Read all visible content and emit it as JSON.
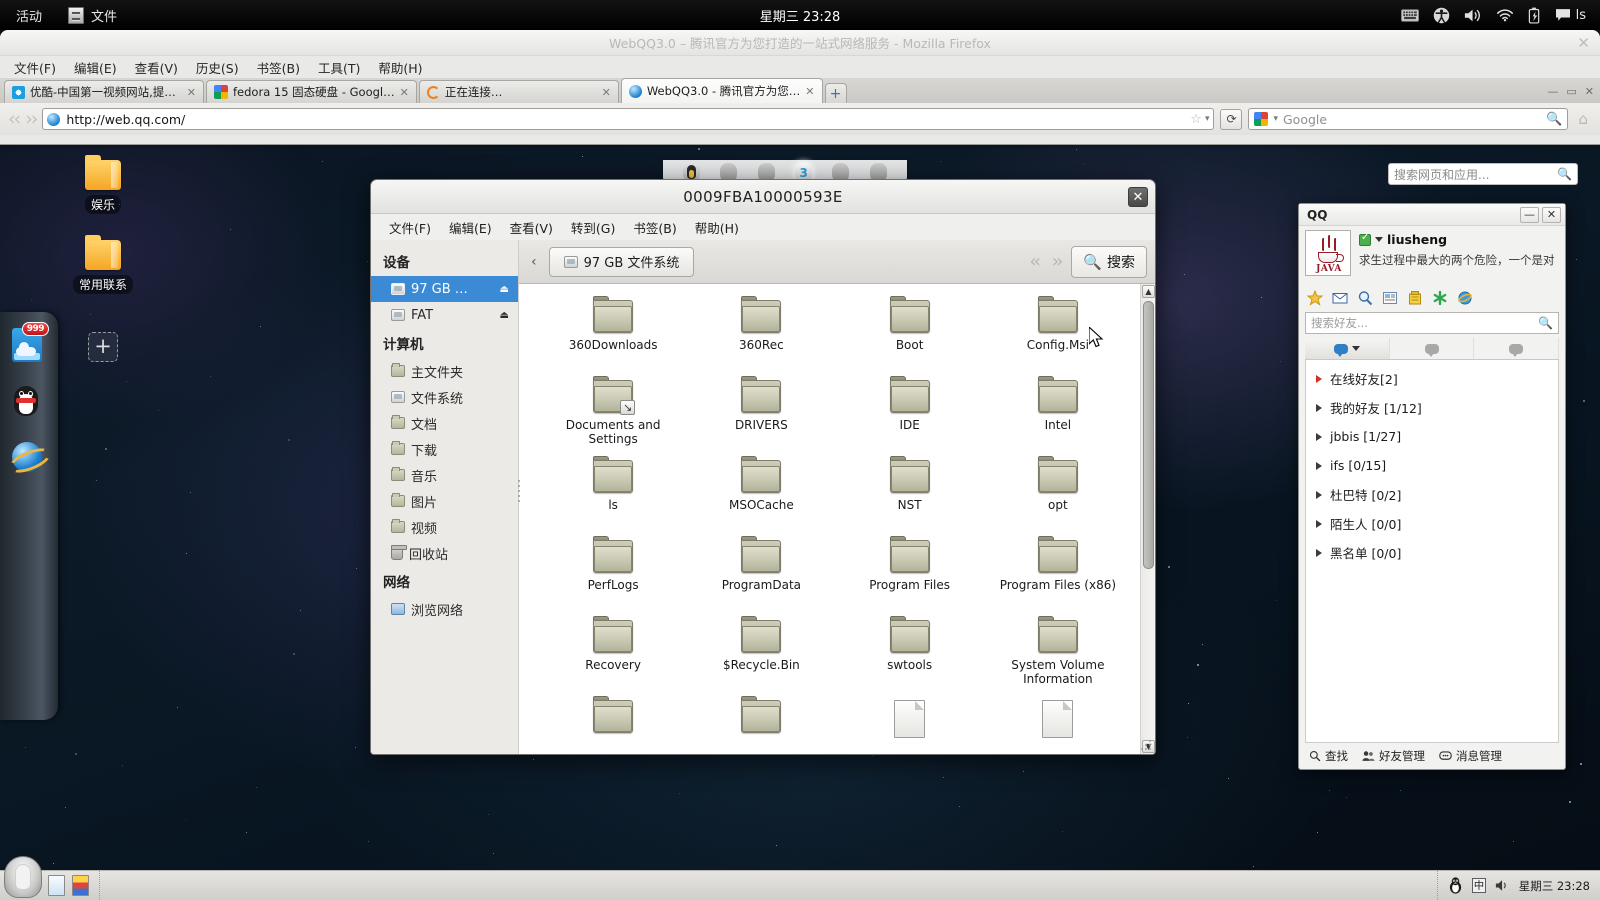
{
  "topbar": {
    "activities": "活动",
    "app_name": "文件",
    "clock": "星期三  23:28",
    "username": "ls",
    "tray_icons": [
      "keyboard-icon",
      "accessibility-icon",
      "volume-icon",
      "wifi-icon",
      "battery-icon",
      "chat-icon"
    ]
  },
  "firefox": {
    "window_title": "WebQQ3.0 – 腾讯官方为您打造的一站式网络服务 - Mozilla Firefox",
    "close_label": "✕",
    "menus": [
      "文件(F)",
      "编辑(E)",
      "查看(V)",
      "历史(S)",
      "书签(B)",
      "工具(T)",
      "帮助(H)"
    ],
    "tabs": [
      {
        "label": "优酷-中国第一视频网站,提…",
        "active": false,
        "favicon": "youku-icon"
      },
      {
        "label": "fedora 15 固态硬盘 - Googl…",
        "active": false,
        "favicon": "google-icon"
      },
      {
        "label": "正在连接…",
        "active": false,
        "favicon": "loading-icon"
      },
      {
        "label": "WebQQ3.0 - 腾讯官方为您…",
        "active": true,
        "favicon": "qq-icon"
      }
    ],
    "newtab_label": "+",
    "window_buttons": [
      "—",
      "▭",
      "✕"
    ],
    "url": "http://web.qq.com/",
    "search_placeholder": "Google",
    "search_engine": "Google",
    "page_search_placeholder": "搜索网页和应用..."
  },
  "desktop": {
    "icons": [
      {
        "label": "娱乐",
        "type": "folder"
      },
      {
        "label": "常用联系",
        "type": "folder"
      }
    ],
    "add_tile_label": "+",
    "dock_items": [
      {
        "name": "weather-widget-icon",
        "badge": "999"
      },
      {
        "name": "qq-penguin-icon",
        "badge": ""
      },
      {
        "name": "ie-browser-icon",
        "badge": ""
      }
    ]
  },
  "pager": {
    "workspaces": 6,
    "current_index": 3,
    "current_label": "3"
  },
  "nautilus": {
    "title": "0009FBA10000593E",
    "close_label": "✕",
    "menus": [
      "文件(F)",
      "编辑(E)",
      "查看(V)",
      "转到(G)",
      "书签(B)",
      "帮助(H)"
    ],
    "sidebar": {
      "sections": [
        {
          "header": "设备",
          "items": [
            {
              "label": "97 GB …",
              "icon": "drive-icon",
              "selected": true,
              "eject": "⏏"
            },
            {
              "label": "FAT",
              "icon": "drive-icon",
              "selected": false,
              "eject": "⏏"
            }
          ]
        },
        {
          "header": "计算机",
          "items": [
            {
              "label": "主文件夹",
              "icon": "home-folder-icon",
              "selected": false,
              "eject": ""
            },
            {
              "label": "文件系统",
              "icon": "filesystem-icon",
              "selected": false,
              "eject": ""
            },
            {
              "label": "文档",
              "icon": "documents-folder-icon",
              "selected": false,
              "eject": ""
            },
            {
              "label": "下载",
              "icon": "downloads-folder-icon",
              "selected": false,
              "eject": ""
            },
            {
              "label": "音乐",
              "icon": "music-folder-icon",
              "selected": false,
              "eject": ""
            },
            {
              "label": "图片",
              "icon": "pictures-folder-icon",
              "selected": false,
              "eject": ""
            },
            {
              "label": "视频",
              "icon": "videos-folder-icon",
              "selected": false,
              "eject": ""
            },
            {
              "label": "回收站",
              "icon": "trash-icon",
              "selected": false,
              "eject": ""
            }
          ]
        },
        {
          "header": "网络",
          "items": [
            {
              "label": "浏览网络",
              "icon": "network-icon",
              "selected": false,
              "eject": ""
            }
          ]
        }
      ]
    },
    "pathbar": {
      "back_chevron": "‹",
      "crumb": "97 GB 文件系统",
      "search_label": "搜索"
    },
    "files": [
      {
        "name": "360Downloads",
        "type": "folder",
        "badge": ""
      },
      {
        "name": "360Rec",
        "type": "folder",
        "badge": ""
      },
      {
        "name": "Boot",
        "type": "folder",
        "badge": ""
      },
      {
        "name": "Config.Msi",
        "type": "folder",
        "badge": ""
      },
      {
        "name": "Documents and Settings",
        "type": "folder",
        "badge": "symlink"
      },
      {
        "name": "DRIVERS",
        "type": "folder",
        "badge": ""
      },
      {
        "name": "IDE",
        "type": "folder",
        "badge": ""
      },
      {
        "name": "Intel",
        "type": "folder",
        "badge": ""
      },
      {
        "name": "ls",
        "type": "folder",
        "badge": ""
      },
      {
        "name": "MSOCache",
        "type": "folder",
        "badge": ""
      },
      {
        "name": "NST",
        "type": "folder",
        "badge": ""
      },
      {
        "name": "opt",
        "type": "folder",
        "badge": ""
      },
      {
        "name": "PerfLogs",
        "type": "folder",
        "badge": ""
      },
      {
        "name": "ProgramData",
        "type": "folder",
        "badge": ""
      },
      {
        "name": "Program Files",
        "type": "folder",
        "badge": ""
      },
      {
        "name": "Program Files (x86)",
        "type": "folder",
        "badge": ""
      },
      {
        "name": "Recovery",
        "type": "folder",
        "badge": ""
      },
      {
        "name": "$Recycle.Bin",
        "type": "folder",
        "badge": ""
      },
      {
        "name": "swtools",
        "type": "folder",
        "badge": ""
      },
      {
        "name": "System Volume Information",
        "type": "folder",
        "badge": ""
      },
      {
        "name": "",
        "type": "folder",
        "badge": ""
      },
      {
        "name": "",
        "type": "folder",
        "badge": ""
      },
      {
        "name": "",
        "type": "document",
        "badge": ""
      },
      {
        "name": "",
        "type": "document",
        "badge": ""
      }
    ]
  },
  "qq": {
    "title": "QQ",
    "minimize_label": "—",
    "close_label": "✕",
    "avatar": "java-logo-avatar",
    "avatar_text": "JAVA",
    "nickname": "liusheng",
    "status": "online",
    "signature": "求生过程中最大的两个危险，一个是对",
    "toolbar_icons": [
      "star-icon",
      "mail-icon",
      "search-icon",
      "news-icon",
      "wallet-icon",
      "app-icon",
      "browser-icon"
    ],
    "search_placeholder": "搜索好友...",
    "tabs": [
      "contacts-tab",
      "groups-tab",
      "recent-tab"
    ],
    "groups": [
      {
        "label": "在线好友[2]",
        "expanded": false,
        "highlight": true
      },
      {
        "label": "我的好友 [1/12]",
        "expanded": false,
        "highlight": false
      },
      {
        "label": "jbbis [1/27]",
        "expanded": false,
        "highlight": false
      },
      {
        "label": "ifs [0/15]",
        "expanded": false,
        "highlight": false
      },
      {
        "label": "杜巴特 [0/2]",
        "expanded": false,
        "highlight": false
      },
      {
        "label": "陌生人 [0/0]",
        "expanded": false,
        "highlight": false
      },
      {
        "label": "黑名单 [0/0]",
        "expanded": false,
        "highlight": false
      }
    ],
    "bottom_buttons": [
      {
        "label": "查找",
        "icon": "search-icon"
      },
      {
        "label": "好友管理",
        "icon": "friends-icon"
      },
      {
        "label": "消息管理",
        "icon": "messages-icon"
      }
    ]
  },
  "taskbar": {
    "launchers": [
      "text-editor-icon",
      "image-viewer-icon"
    ],
    "tray": [
      "tux-icon",
      "ibus-icon",
      "volume-icon"
    ],
    "clock": "星期三 23:28",
    "start_button": "tux-start-button"
  }
}
